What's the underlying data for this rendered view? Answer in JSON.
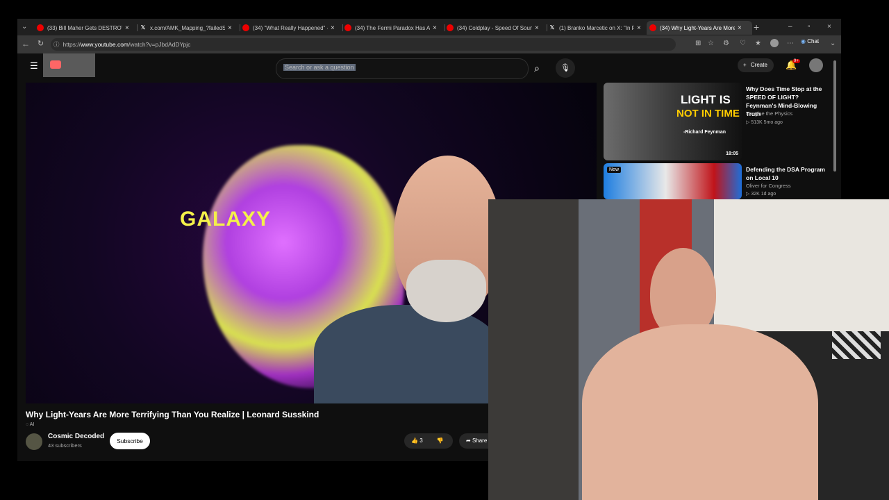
{
  "tabs": [
    {
      "title": "(33) Bill Maher Gets DESTROYED",
      "icon": "youtube-icon",
      "active": false
    },
    {
      "title": "x.com/AMK_Mapping_?failedScript",
      "icon": "x-icon",
      "active": false
    },
    {
      "title": "(34) \"What Really Happened\" - Re",
      "icon": "youtube-icon",
      "active": false
    },
    {
      "title": "(34) The Fermi Paradox Has A Dark",
      "icon": "youtube-icon",
      "active": false
    },
    {
      "title": "(34) Coldplay - Speed Of Sound (",
      "icon": "youtube-icon",
      "active": false
    },
    {
      "title": "(1) Branko Marcetic on X: \"In Feb",
      "icon": "x-icon",
      "active": false
    },
    {
      "title": "(34) Why Light-Years Are More Te",
      "icon": "youtube-icon",
      "active": true
    }
  ],
  "address": {
    "url_prefix": "https://",
    "url_host": "www.youtube.com",
    "url_path": "/watch?v=pJbdAdDYpjc"
  },
  "toolbar": {
    "chat_label": "Chat"
  },
  "youtube": {
    "search_placeholder": "Search or ask a question",
    "create_label": "Create",
    "notifications_count": "9+"
  },
  "video": {
    "overlay_text": "GALAXY",
    "title": "Why Light-Years Are More Terrifying Than You Realize | Leonard Susskind",
    "ai_label": "AI",
    "channel": "Cosmic Decoded",
    "subscribers": "43 subscribers",
    "subscribe_label": "Subscribe",
    "likes": "3",
    "share_label": "Share"
  },
  "recommendations": [
    {
      "title": "Why Does Time Stop at the SPEED OF LIGHT? Feynman's Mind-Blowing Truth",
      "channel": "Imagine the Physics",
      "meta": "513K  5mo ago",
      "duration": "18:05",
      "thumb_line1": "LIGHT IS",
      "thumb_line2": "NOT IN TIME",
      "thumb_caption": "-Richard Feynman",
      "badge": ""
    },
    {
      "title": "Defending the DSA Program on Local 10",
      "channel": "Oliver for Congress",
      "meta": "32K  1d ago",
      "duration": "",
      "thumb_line1": "",
      "thumb_line2": "",
      "thumb_caption": "",
      "badge": "New"
    }
  ]
}
